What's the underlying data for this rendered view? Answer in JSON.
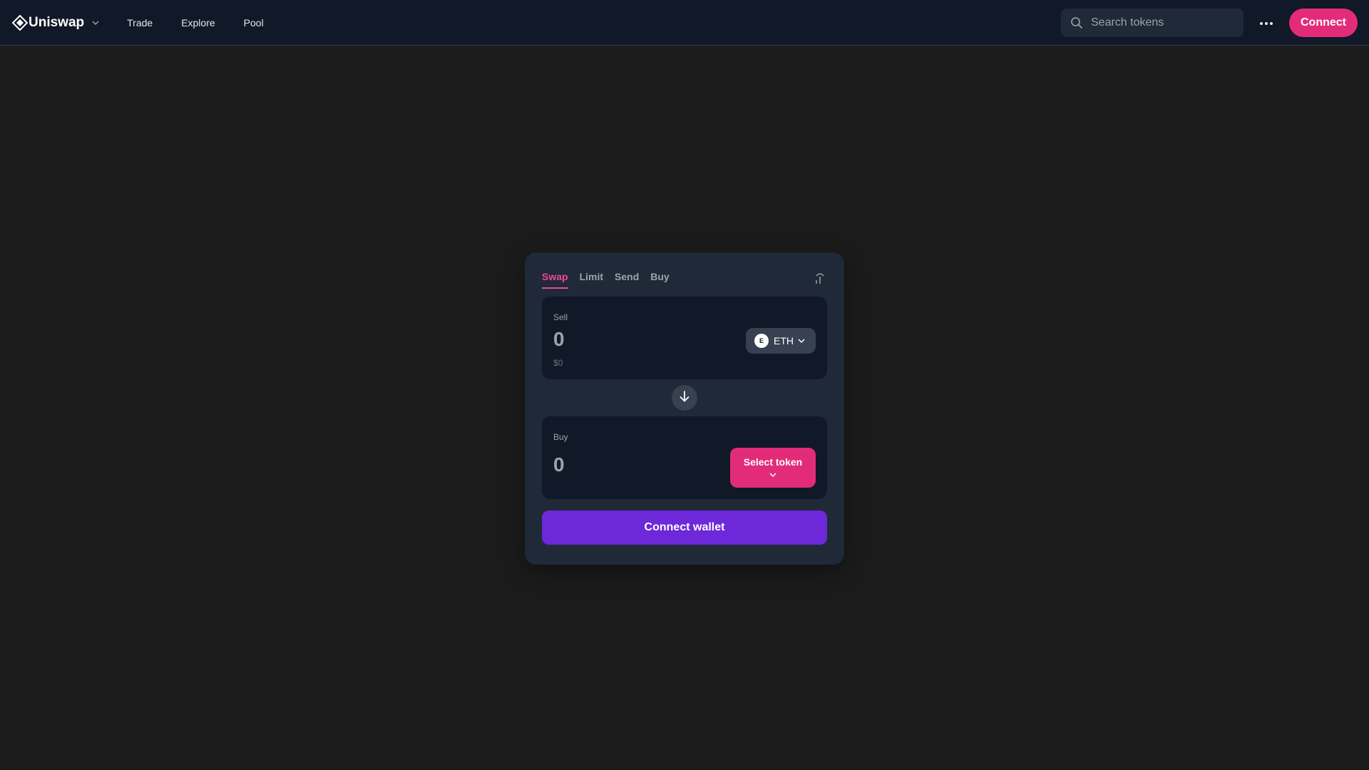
{
  "colors": {
    "background": "#1b1b1b",
    "topbar": "#111827",
    "card": "#1f2937",
    "panel": "#111827",
    "accent_pink": "#e22c7a",
    "tab_active": "#ec4899",
    "primary_purple": "#6d28d9"
  },
  "header": {
    "brand": "Uniswap",
    "brand_icon": "uniswap-logo-icon",
    "nav": [
      "Trade",
      "Explore",
      "Pool"
    ],
    "search_placeholder": "Search tokens",
    "search_icon": "search-icon",
    "more_icon": "more-horizontal-icon",
    "connect_label": "Connect"
  },
  "swap": {
    "tabs": [
      "Swap",
      "Limit",
      "Send",
      "Buy"
    ],
    "active_tab": "Swap",
    "settings_icon": "settings-icon",
    "sell": {
      "label": "Sell",
      "amount": "0",
      "usd": "$0",
      "token_symbol": "ETH",
      "token_badge": "E"
    },
    "switch_icon": "arrow-down-icon",
    "buy": {
      "label": "Buy",
      "amount": "0",
      "select_label": "Select token"
    },
    "connect_wallet_label": "Connect wallet"
  }
}
